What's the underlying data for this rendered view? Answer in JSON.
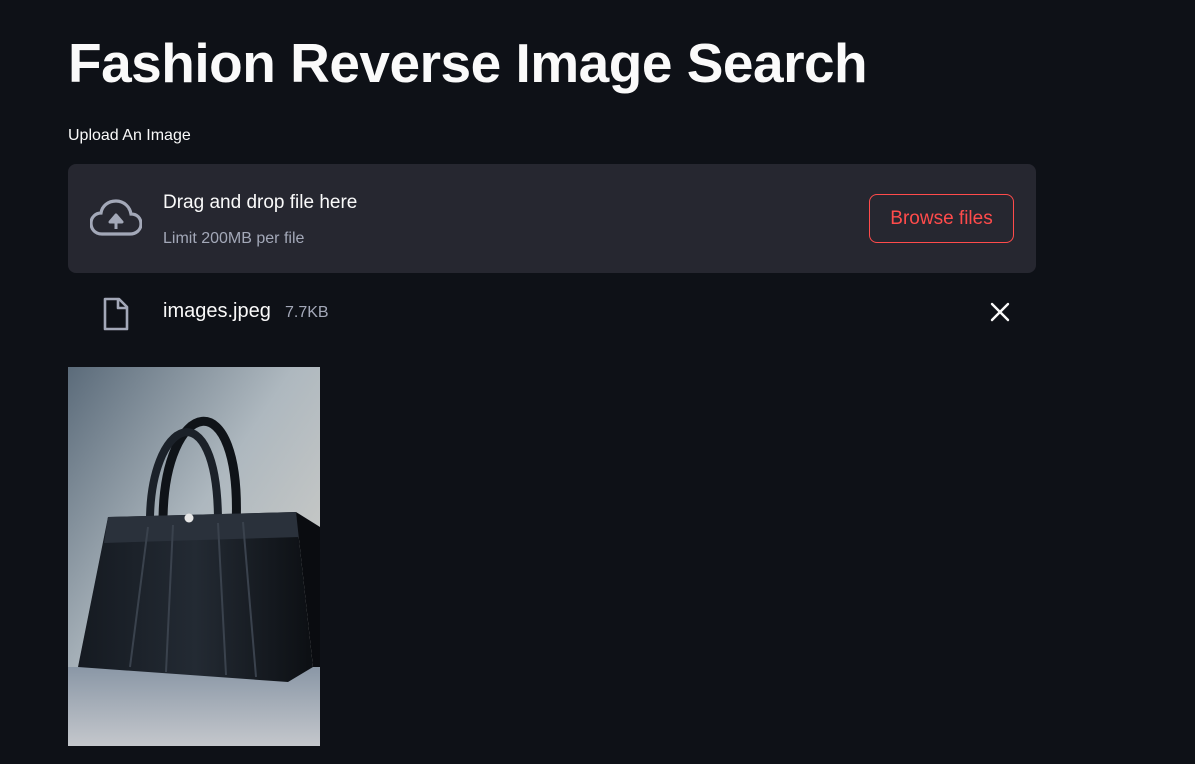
{
  "header": {
    "title": "Fashion Reverse Image Search"
  },
  "uploader": {
    "label": "Upload An Image",
    "drop_text": "Drag and drop file here",
    "limit_text": "Limit 200MB per file",
    "browse_label": "Browse files",
    "upload_icon": "cloud-upload-icon"
  },
  "uploaded_file": {
    "name": "images.jpeg",
    "size": "7.7KB",
    "file_icon": "file-icon",
    "remove_icon": "close-icon"
  },
  "preview": {
    "subject": "black leather tote handbag"
  },
  "colors": {
    "background": "#0e1117",
    "panel": "#262730",
    "accent": "#ff4b4b",
    "muted_text": "#a3a8b8"
  }
}
